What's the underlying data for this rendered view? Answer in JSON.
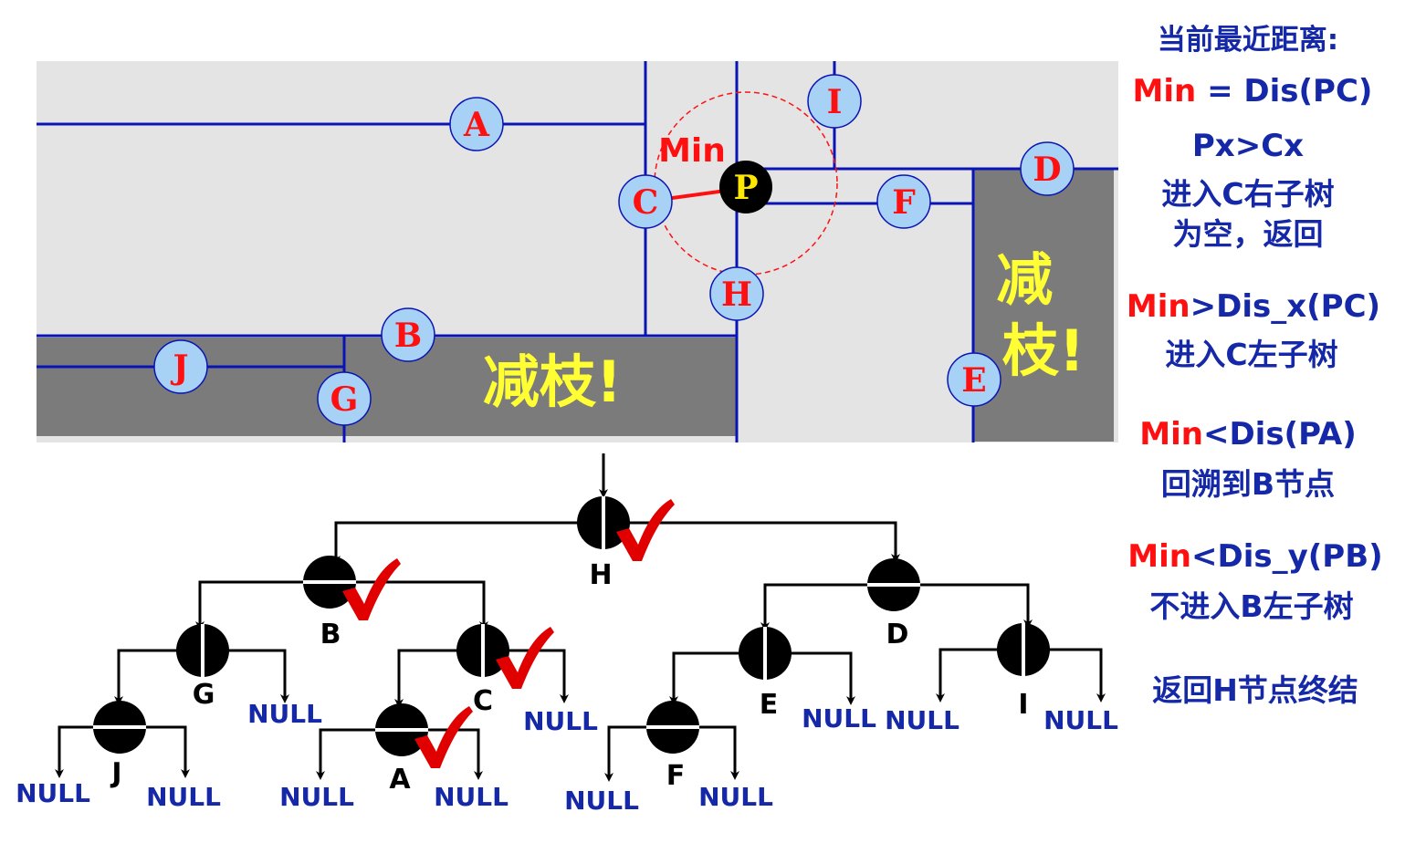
{
  "colors": {
    "region_fill": "#e4e4e4",
    "pruned_fill": "#7b7b7b",
    "split_line": "#0a14b4",
    "point_fill": "#a7d1f5",
    "point_text": "#ff1010",
    "query_fill": "#000000",
    "query_text": "#ffe800",
    "min_line": "#ff1010",
    "prune_text": "#ffff33",
    "tree_line": "#000000",
    "null_text": "#1428a8",
    "check": "#e00000"
  },
  "map": {
    "points": [
      {
        "label": "A"
      },
      {
        "label": "B"
      },
      {
        "label": "C"
      },
      {
        "label": "D"
      },
      {
        "label": "E"
      },
      {
        "label": "F"
      },
      {
        "label": "G"
      },
      {
        "label": "H"
      },
      {
        "label": "I"
      },
      {
        "label": "J"
      }
    ],
    "query_point": "P",
    "min_label": "Min",
    "prune_label_bottom": "减枝!",
    "prune_label_right": "减\n枝!"
  },
  "tree": {
    "nodes": [
      {
        "label": "H",
        "split": "vertical",
        "checked": true
      },
      {
        "label": "B",
        "split": "horizontal",
        "checked": true
      },
      {
        "label": "D",
        "split": "horizontal",
        "checked": false
      },
      {
        "label": "G",
        "split": "vertical",
        "checked": false
      },
      {
        "label": "C",
        "split": "vertical",
        "checked": true
      },
      {
        "label": "E",
        "split": "vertical",
        "checked": false
      },
      {
        "label": "I",
        "split": "vertical",
        "checked": false
      },
      {
        "label": "J",
        "split": "horizontal",
        "checked": false
      },
      {
        "label": "A",
        "split": "horizontal",
        "checked": true
      },
      {
        "label": "F",
        "split": "horizontal",
        "checked": false
      }
    ],
    "null_label": "NULL"
  },
  "side": {
    "title": "当前最近距离:",
    "min_word": "Min",
    "eq1_rest": " = Dis(PC)",
    "step1_a": "Px>Cx",
    "step1_b": "进入C右子树",
    "step1_c": "为空，返回",
    "step2_rest": ">Dis_x(PC)",
    "step2_b": "进入C左子树",
    "step3_rest": "<Dis(PA)",
    "step3_b": "回溯到B节点",
    "step4_rest": "<Dis_y(PB)",
    "step4_b": "不进入B左子树",
    "step5": "返回H节点终结"
  }
}
